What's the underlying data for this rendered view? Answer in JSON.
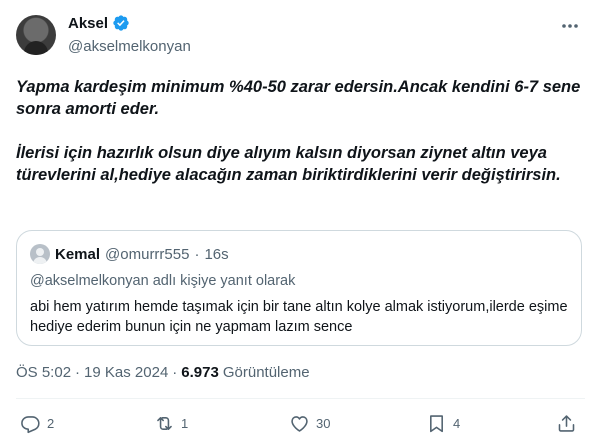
{
  "author": {
    "display_name": "Aksel",
    "handle": "@akselmelkonyan",
    "verified": true
  },
  "tweet": {
    "paragraphs": [
      "Yapma kardeşim minimum %40-50 zarar edersin.Ancak kendini 6-7 sene sonra amorti eder.",
      "İlerisi için hazırlık olsun diye alıyım kalsın diyorsan ziynet altın veya türevlerini al,hediye alacağın zaman biriktirdiklerini verir değiştirirsin."
    ]
  },
  "quoted_tweet": {
    "name": "Kemal",
    "handle": "@omurrr555",
    "separator": "·",
    "time": "16s",
    "reply_context": "@akselmelkonyan adlı kişiye yanıt olarak",
    "text": "abi hem yatırım hemde taşımak için bir tane altın kolye almak istiyorum,ilerde eşime hediye ederim bunun için ne yapmam lazım sence"
  },
  "meta": {
    "time": "ÖS 5:02",
    "separator1": "·",
    "date": "19 Kas 2024",
    "separator2": "·",
    "views_count": "6.973",
    "views_label": "Görüntüleme"
  },
  "actions": {
    "replies": "2",
    "reposts": "1",
    "likes": "30",
    "bookmarks": "4"
  },
  "colors": {
    "text": "#0f1419",
    "secondary": "#536471",
    "verified": "#1d9bf0",
    "border": "#cfd9de"
  }
}
